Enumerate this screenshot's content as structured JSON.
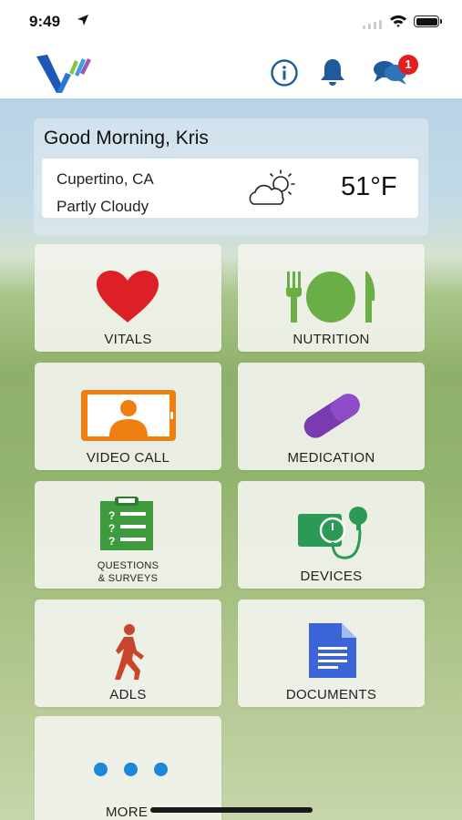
{
  "status_bar": {
    "time": "9:49"
  },
  "header": {
    "notification_count": "1"
  },
  "greeting": "Good Morning, Kris",
  "weather": {
    "location": "Cupertino, CA",
    "condition": "Partly Cloudy",
    "temperature": "51°F"
  },
  "tiles": [
    {
      "label": "VITALS",
      "icon": "heart-icon",
      "color": "#dd1f26"
    },
    {
      "label": "NUTRITION",
      "icon": "plate-fork-knife-icon",
      "color": "#6aae46"
    },
    {
      "label": "VIDEO CALL",
      "icon": "video-call-icon",
      "color": "#f07f12"
    },
    {
      "label": "MEDICATION",
      "icon": "pill-icon",
      "color": "#7a3bb0"
    },
    {
      "label": "QUESTIONS\n& SURVEYS",
      "label_line1": "QUESTIONS",
      "label_line2": "& SURVEYS",
      "icon": "clipboard-questions-icon",
      "color": "#3d9a3d"
    },
    {
      "label": "DEVICES",
      "icon": "blood-pressure-device-icon",
      "color": "#2a9a55"
    },
    {
      "label": "ADLS",
      "icon": "walking-person-icon",
      "color": "#c8442a"
    },
    {
      "label": "DOCUMENTS",
      "icon": "document-icon",
      "color": "#3b64d8"
    },
    {
      "label": "MORE",
      "icon": "more-dots-icon",
      "color": "#1e88d8"
    }
  ]
}
